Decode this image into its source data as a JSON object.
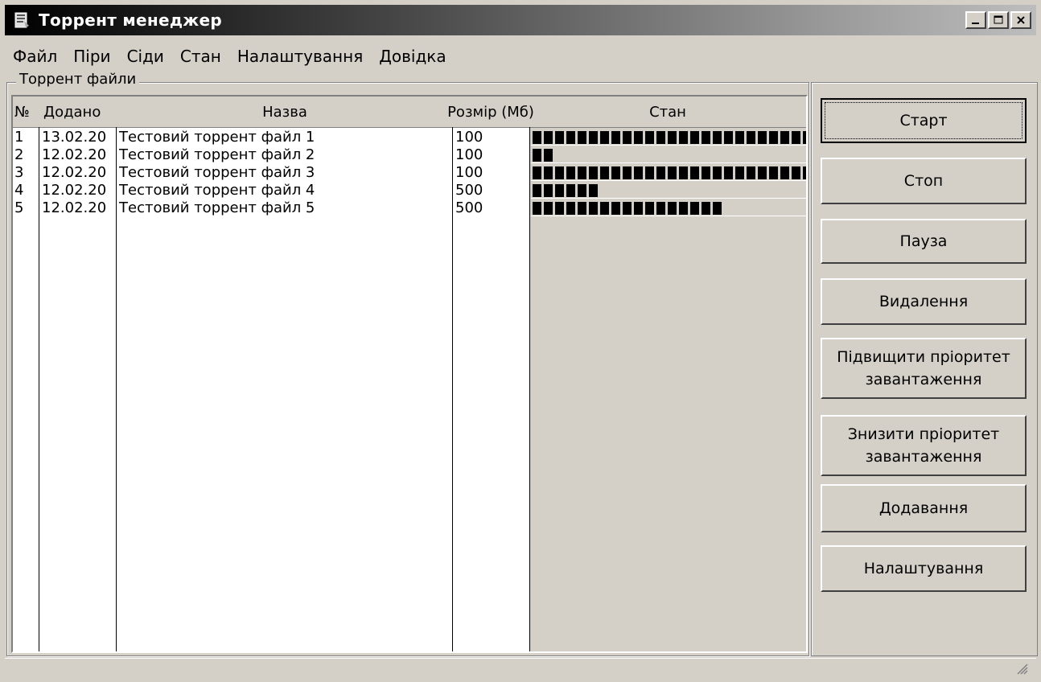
{
  "window": {
    "title": "Торрент менеджер",
    "icon": "torrent-app-icon",
    "controls": [
      "minimize-icon",
      "maximize-icon",
      "close-icon"
    ]
  },
  "menu": [
    "Файл",
    "Піри",
    "Сіди",
    "Стан",
    "Налаштування",
    "Довідка"
  ],
  "group_label": "Торрент файли",
  "table": {
    "columns": [
      "№",
      "Додано",
      "Назва",
      "Розмір (Мб)",
      "Стан"
    ],
    "rows": [
      {
        "num": "1",
        "added": "13.02.20",
        "name": "Тестовий торрент файл 1",
        "size": "100",
        "progress": 1.0
      },
      {
        "num": "2",
        "added": "12.02.20",
        "name": "Тестовий торрент файл 2",
        "size": "100",
        "progress": 0.08
      },
      {
        "num": "3",
        "added": "12.02.20",
        "name": "Тестовий торрент файл 3",
        "size": "100",
        "progress": 1.0
      },
      {
        "num": "4",
        "added": "12.02.20",
        "name": "Тестовий торрент файл 4",
        "size": "500",
        "progress": 0.24
      },
      {
        "num": "5",
        "added": "12.02.20",
        "name": "Тестовий торрент файл 5",
        "size": "500",
        "progress": 0.7
      }
    ]
  },
  "buttons": {
    "start": "Старт",
    "stop": "Стоп",
    "pause": "Пауза",
    "delete": "Видалення",
    "raise_priority_1": "Підвищити пріоритет",
    "raise_priority_2": "завантаження",
    "lower_priority_1": "Знизити пріоритет",
    "lower_priority_2": "завантаження",
    "add": "Додавання",
    "settings": "Налаштування"
  },
  "colors": {
    "face": "#d4d0c8",
    "progress": "#000000",
    "title_text": "#ffffff"
  }
}
